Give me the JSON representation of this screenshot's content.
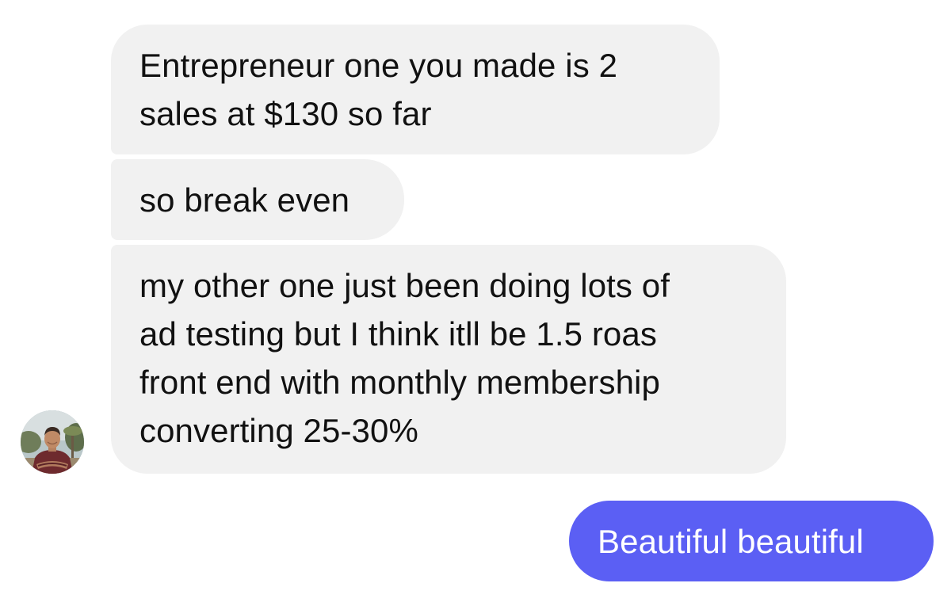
{
  "conversation": {
    "messages": [
      {
        "sender": "contact",
        "text": "Entrepreneur one you made is 2\nsales at $130 so far"
      },
      {
        "sender": "contact",
        "text": "so break even"
      },
      {
        "sender": "contact",
        "text": "my other one just been doing lots of\nad testing but I think itll be 1.5 roas\nfront end with monthly membership\nconverting 25-30%"
      },
      {
        "sender": "me",
        "text": "Beautiful beautiful"
      }
    ],
    "contact_avatar_icon": "profile-photo-avatar"
  },
  "colors": {
    "incoming_bubble": "#f1f1f1",
    "incoming_text": "#111111",
    "outgoing_bubble": "#5b5ff4",
    "outgoing_text": "#ffffff"
  }
}
